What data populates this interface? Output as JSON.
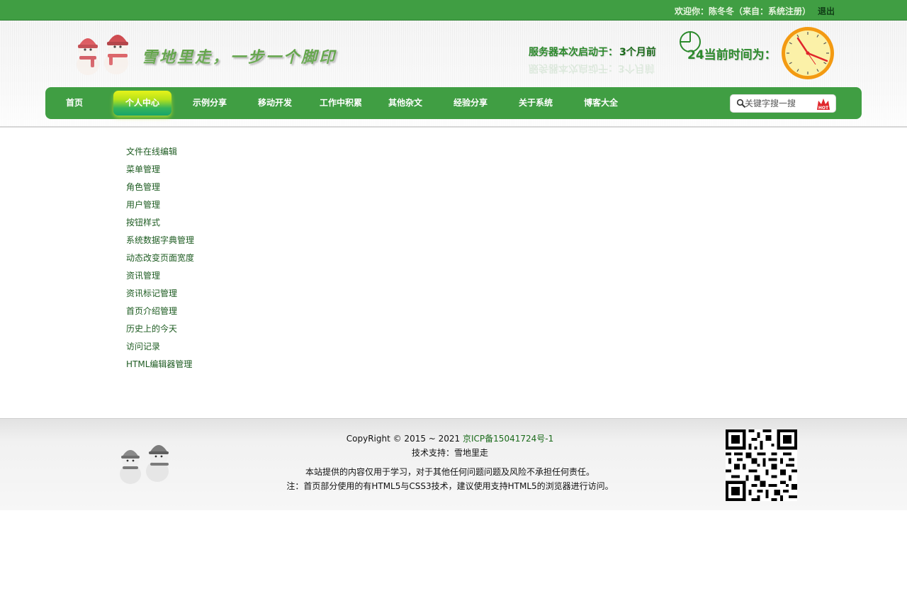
{
  "topbar": {
    "welcome_text": "欢迎你：陈冬冬（来自：系统注册）",
    "logout_label": "退出"
  },
  "header": {
    "slogan": "雪地里走，一步一个脚印",
    "server_label": "服务器本次启动于：",
    "server_uptime": "3个月前",
    "clock_number": "24",
    "now_label": "当前时间为："
  },
  "nav": {
    "items": [
      {
        "label": "首页"
      },
      {
        "label": "个人中心"
      },
      {
        "label": "示例分享"
      },
      {
        "label": "移动开发"
      },
      {
        "label": "工作中积累"
      },
      {
        "label": "其他杂文"
      },
      {
        "label": "经验分享"
      },
      {
        "label": "关于系统"
      },
      {
        "label": "博客大全"
      }
    ],
    "active_index": 1,
    "search_placeholder": "关键字搜一搜",
    "hot_badge": "HOT"
  },
  "menu": {
    "items": [
      {
        "label": "文件在线编辑"
      },
      {
        "label": "菜单管理"
      },
      {
        "label": "角色管理"
      },
      {
        "label": "用户管理"
      },
      {
        "label": "按钮样式"
      },
      {
        "label": "系统数据字典管理"
      },
      {
        "label": "动态改变页面宽度"
      },
      {
        "label": "资讯管理"
      },
      {
        "label": "资讯标记管理"
      },
      {
        "label": "首页介绍管理"
      },
      {
        "label": "历史上的今天"
      },
      {
        "label": "访问记录"
      },
      {
        "label": "HTML编辑器管理"
      }
    ]
  },
  "footer": {
    "copyright": "CopyRight © 2015 ~ 2021 ",
    "icp_link": "京ICP备15041724号-1",
    "support": "技术支持：雪地里走",
    "disclaimer": "本站提供的内容仅用于学习，对于其他任何问题问题及风险不承担任何责任。",
    "note": "注：首页部分使用的有HTML5与CSS3技术，建议使用支持HTML5的浏览器进行访问。"
  },
  "colors": {
    "brand_green": "#409e43",
    "link_green": "#1e5c22",
    "active_tab_yellow": "#e7f31a"
  },
  "icons": [
    "snowman-logo",
    "crosshair-icon",
    "clock-icon",
    "search-icon",
    "hot-icon",
    "qr-code"
  ]
}
